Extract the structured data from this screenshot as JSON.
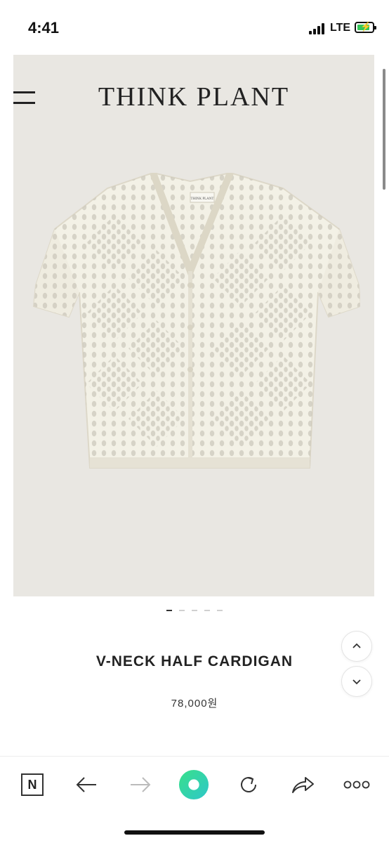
{
  "status_bar": {
    "time": "4:41",
    "network": "LTE",
    "battery_icon": "battery-charging-icon",
    "accent": "#34c759"
  },
  "site": {
    "brand": "THINK PLANT",
    "menu_icon": "hamburger-menu-icon"
  },
  "gallery": {
    "current_slide": 1,
    "total_slides": 5
  },
  "product": {
    "name": "V-NECK HALF CARDIGAN",
    "price": "78,000원",
    "tag_label": "THINK PLANT"
  },
  "floating": {
    "up_icon": "chevron-up-icon",
    "down_icon": "chevron-down-icon"
  },
  "toolbar": {
    "home_label": "N",
    "items": [
      "naver-home-icon",
      "back-arrow-icon",
      "forward-arrow-icon",
      "green-dot-icon",
      "refresh-icon",
      "share-icon",
      "more-icon"
    ],
    "green": "#3ddc97"
  }
}
